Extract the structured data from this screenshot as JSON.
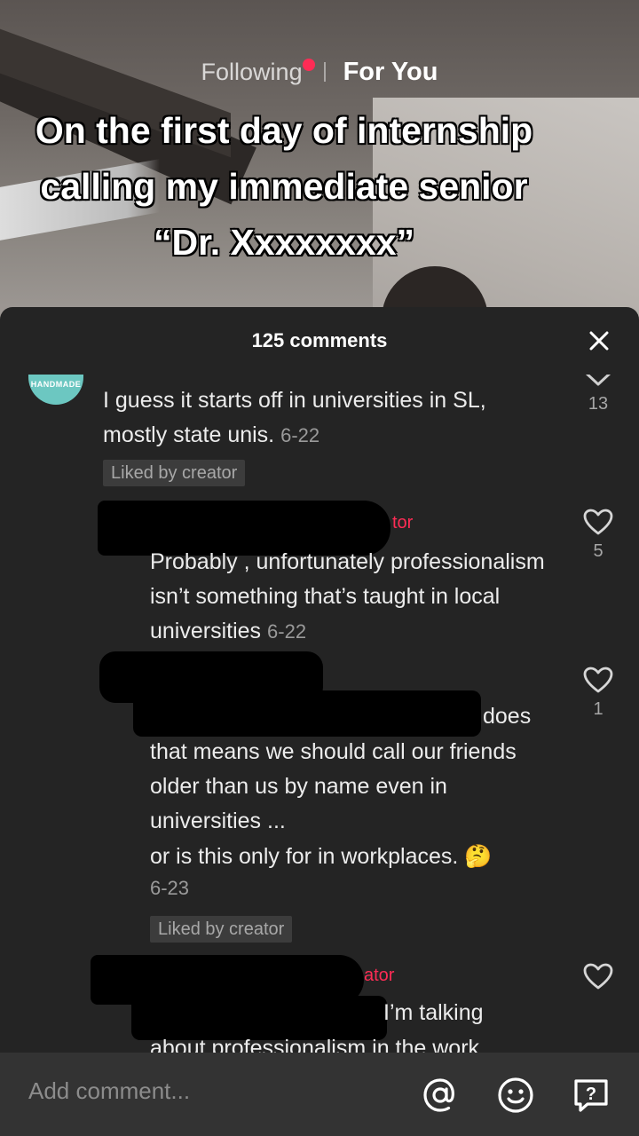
{
  "top_nav": {
    "following_label": "Following",
    "for_you_label": "For You"
  },
  "video": {
    "caption": "On the first day of internship calling my immediate senior “Dr. Xxxxxxxx”"
  },
  "comments_panel": {
    "count_label": "125 comments",
    "close_icon": "close-icon",
    "comments": [
      {
        "avatar_text": "HANDMADE",
        "text": "I guess it starts off in universities in SL, mostly state unis.",
        "date": "6-22",
        "liked_by_creator": "Liked by creator",
        "like_count": "13",
        "like_icon": "chevron-down-icon"
      },
      {
        "creator_tag": "tor",
        "text": "Probably , unfortunately professionalism isn’t something that’s taught in local universities",
        "date": "6-22",
        "like_count": "5",
        "like_icon": "heart-icon"
      },
      {
        "text_line1": "does",
        "text_rest": "that means we should call our friends older than us by name even in universities ...",
        "text_last": "or is this only for in workplaces. 🤔",
        "date": "6-23",
        "liked_by_creator": "Liked by creator",
        "like_count": "1",
        "like_icon": "heart-icon"
      },
      {
        "creator_tag": "ator",
        "text_line1": "I’m talking",
        "text_line2": "about professionalism in the work",
        "like_icon": "heart-icon"
      }
    ]
  },
  "input_bar": {
    "placeholder": "Add comment...",
    "icons": [
      "at-icon",
      "emoji-icon",
      "question-icon"
    ]
  },
  "colors": {
    "accent": "#fe2c55",
    "sheet_bg": "#242424",
    "input_bg": "#333333"
  }
}
